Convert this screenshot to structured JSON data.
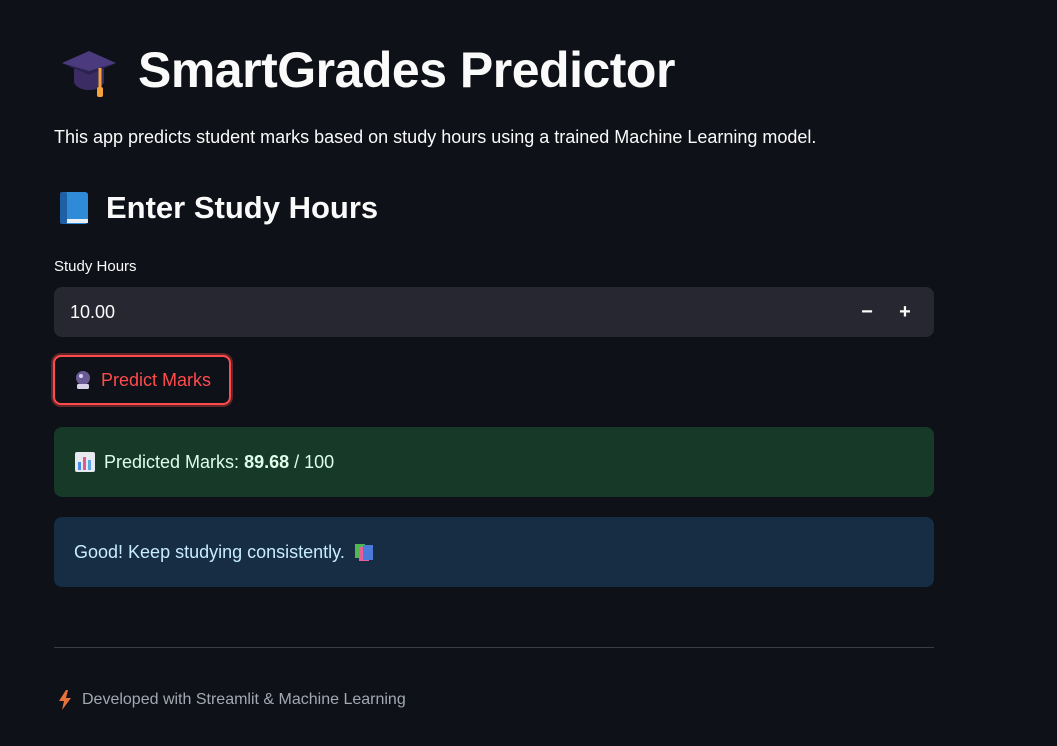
{
  "header": {
    "title": "SmartGrades Predictor",
    "title_icon": "graduation-cap-icon",
    "description": "This app predicts student marks based on study hours using a trained Machine Learning model."
  },
  "section": {
    "title": "Enter Study Hours",
    "icon": "blue-book-icon"
  },
  "input": {
    "label": "Study Hours",
    "value": "10.00",
    "decrement": "−",
    "increment": "+"
  },
  "button": {
    "label": "Predict Marks",
    "icon": "crystal-ball-icon",
    "accent_color": "#ff4b4b"
  },
  "result": {
    "icon": "bar-chart-icon",
    "prefix": "Predicted Marks:",
    "value": "89.68",
    "suffix": "/ 100",
    "color": "#173928"
  },
  "message": {
    "text": "Good! Keep studying consistently.",
    "icon": "books-icon",
    "color": "#172d43"
  },
  "footer": {
    "icon": "lightning-icon",
    "text": "Developed with Streamlit & Machine Learning"
  }
}
